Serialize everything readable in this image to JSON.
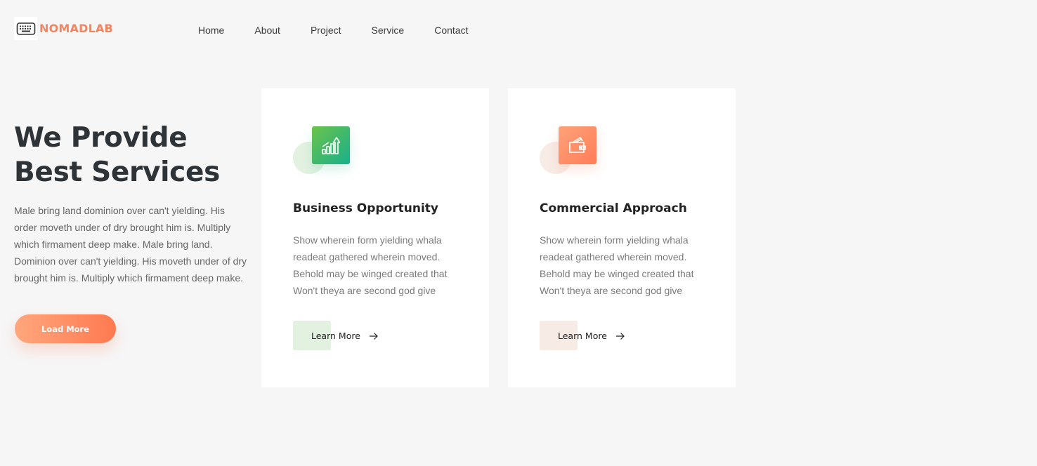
{
  "brand": {
    "name": "NOMADLAB",
    "logo_icon": "keyboard-icon",
    "color": "#f4845f"
  },
  "nav": {
    "items": [
      "Home",
      "About",
      "Project",
      "Service",
      "Contact"
    ]
  },
  "hero": {
    "title_line1": "We Provide",
    "title_line2": "Best Services",
    "description": "Male bring land dominion over can't yielding. His order moveth under of dry brought him is. Multiply which firmament deep make. Male bring land. Dominion over can't yielding. His moveth under of dry brought him is. Multiply which firmament deep make.",
    "button_label": "Load More"
  },
  "cards": [
    {
      "title": "Business Opportunity",
      "text": "Show wherein form yielding whala readeat gathered wherein moved. Behold may be winged created that Won't theya are second god give",
      "link_label": "Learn More",
      "icon": "growth-chart-icon",
      "accent": "#18b08b"
    },
    {
      "title": "Commercial Approach",
      "text": "Show wherein form yielding whala readeat gathered wherein moved. Behold may be winged created that Won't theya are second god give",
      "link_label": "Learn More",
      "icon": "wallet-icon",
      "accent": "#ff7d57"
    }
  ]
}
